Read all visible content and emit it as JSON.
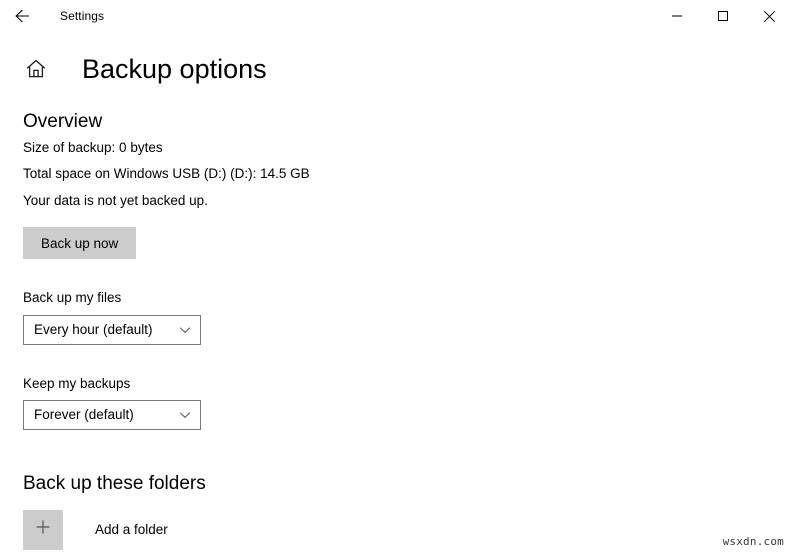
{
  "titlebar": {
    "back_icon": "back-arrow-icon",
    "title": "Settings",
    "minimize_icon": "minimize-icon",
    "maximize_icon": "maximize-icon",
    "close_icon": "close-icon"
  },
  "header": {
    "home_icon": "home-icon",
    "title": "Backup options"
  },
  "overview": {
    "heading": "Overview",
    "size_of_backup": "Size of backup: 0 bytes",
    "total_space": "Total space on Windows USB (D:) (D:): 14.5 GB",
    "status": "Your data is not yet backed up.",
    "backup_now_label": "Back up now"
  },
  "backup_frequency": {
    "label": "Back up my files",
    "value": "Every hour (default)",
    "chevron_icon": "chevron-down-icon"
  },
  "keep_backups": {
    "label": "Keep my backups",
    "value": "Forever (default)",
    "chevron_icon": "chevron-down-icon"
  },
  "folders": {
    "heading": "Back up these folders",
    "add_icon": "plus-icon",
    "add_label": "Add a folder"
  },
  "watermark": {
    "text": "wsxdn.com"
  },
  "colors": {
    "background": "#ffffff",
    "button_fill": "#cccccc",
    "dropdown_border": "#7a7a7a",
    "text": "#000000"
  }
}
